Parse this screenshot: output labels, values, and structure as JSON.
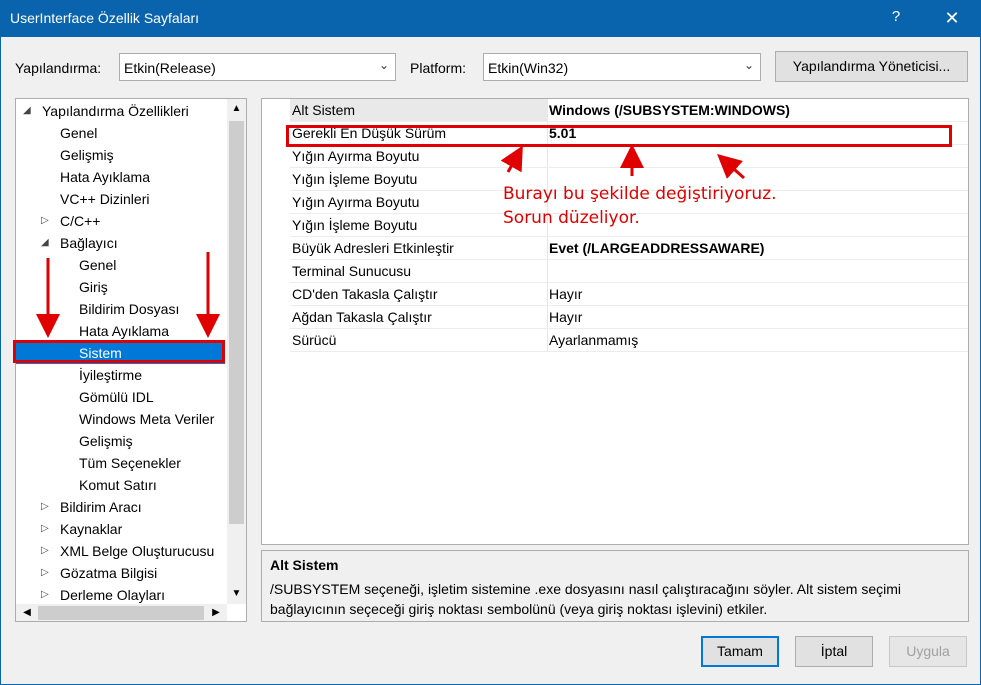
{
  "window": {
    "title": "UserInterface Özellik Sayfaları",
    "help_label": "?",
    "close_label": "✕"
  },
  "toolbar": {
    "config_label": "Yapılandırma:",
    "config_value": "Etkin(Release)",
    "platform_label": "Platform:",
    "platform_value": "Etkin(Win32)",
    "manager_button": "Yapılandırma Yöneticisi..."
  },
  "tree": {
    "items": [
      {
        "label": "Yapılandırma Özellikleri",
        "toggle": "◢"
      },
      {
        "label": "Genel"
      },
      {
        "label": "Gelişmiş"
      },
      {
        "label": "Hata Ayıklama"
      },
      {
        "label": "VC++ Dizinleri"
      },
      {
        "label": "C/C++",
        "toggle": "▷"
      },
      {
        "label": "Bağlayıcı",
        "toggle": "◢"
      },
      {
        "label": "Genel"
      },
      {
        "label": "Giriş"
      },
      {
        "label": "Bildirim Dosyası"
      },
      {
        "label": "Hata Ayıklama"
      },
      {
        "label": "Sistem"
      },
      {
        "label": "İyileştirme"
      },
      {
        "label": "Gömülü IDL"
      },
      {
        "label": "Windows Meta Veriler"
      },
      {
        "label": "Gelişmiş"
      },
      {
        "label": "Tüm Seçenekler"
      },
      {
        "label": "Komut Satırı"
      },
      {
        "label": "Bildirim Aracı",
        "toggle": "▷"
      },
      {
        "label": "Kaynaklar",
        "toggle": "▷"
      },
      {
        "label": "XML Belge Oluşturucusu",
        "toggle": "▷"
      },
      {
        "label": "Gözatma Bilgisi",
        "toggle": "▷"
      },
      {
        "label": "Derleme Olayları",
        "toggle": "▷"
      }
    ],
    "selected": "Sistem"
  },
  "properties": [
    {
      "name": "Alt Sistem",
      "value": "Windows (/SUBSYSTEM:WINDOWS)",
      "bold": true
    },
    {
      "name": "Gerekli En Düşük Sürüm",
      "value": "5.01",
      "bold": true
    },
    {
      "name": "Yığın Ayırma Boyutu",
      "value": ""
    },
    {
      "name": "Yığın İşleme Boyutu",
      "value": ""
    },
    {
      "name": "Yığın Ayırma Boyutu",
      "value": ""
    },
    {
      "name": "Yığın İşleme Boyutu",
      "value": ""
    },
    {
      "name": "Büyük Adresleri Etkinleştir",
      "value": "Evet (/LARGEADDRESSAWARE)",
      "bold": true
    },
    {
      "name": "Terminal Sunucusu",
      "value": ""
    },
    {
      "name": "CD'den Takasla Çalıştır",
      "value": "Hayır"
    },
    {
      "name": "Ağdan Takasla Çalıştır",
      "value": "Hayır"
    },
    {
      "name": "Sürücü",
      "value": "Ayarlanmamış"
    }
  ],
  "annotation": {
    "line1": "Burayı bu şekilde değiştiriyoruz.",
    "line2": "Sorun düzeliyor."
  },
  "description": {
    "title": "Alt Sistem",
    "body": "/SUBSYSTEM seçeneği, işletim sistemine .exe dosyasını nasıl çalıştıracağını söyler. Alt sistem seçimi bağlayıcının seçeceği giriş noktası sembolünü (veya giriş noktası işlevini) etkiler."
  },
  "buttons": {
    "ok": "Tamam",
    "cancel": "İptal",
    "apply": "Uygula"
  },
  "colors": {
    "titlebar": "#0a64ad",
    "selection": "#0078d7",
    "annotation_red": "#e00000"
  }
}
